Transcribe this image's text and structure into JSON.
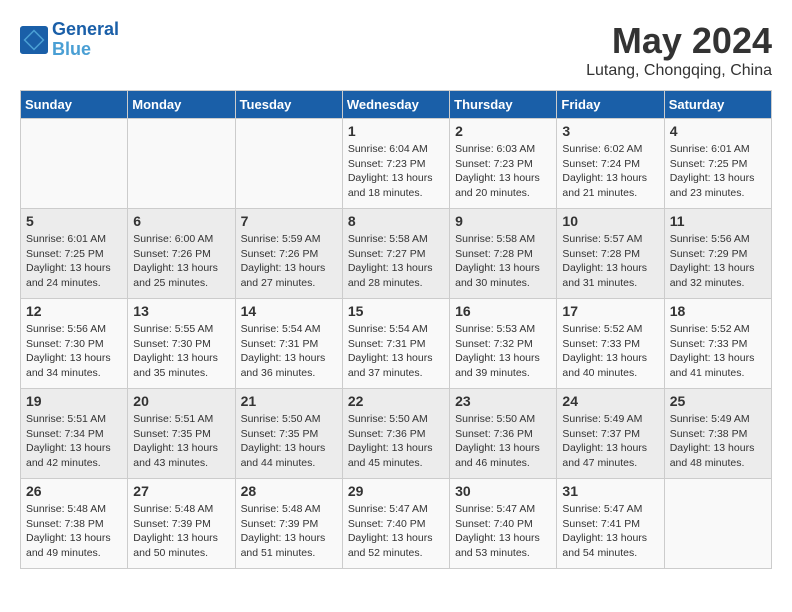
{
  "header": {
    "logo_line1": "General",
    "logo_line2": "Blue",
    "main_title": "May 2024",
    "subtitle": "Lutang, Chongqing, China"
  },
  "weekdays": [
    "Sunday",
    "Monday",
    "Tuesday",
    "Wednesday",
    "Thursday",
    "Friday",
    "Saturday"
  ],
  "weeks": [
    [
      {
        "day": "",
        "info": ""
      },
      {
        "day": "",
        "info": ""
      },
      {
        "day": "",
        "info": ""
      },
      {
        "day": "1",
        "info": "Sunrise: 6:04 AM\nSunset: 7:23 PM\nDaylight: 13 hours and 18 minutes."
      },
      {
        "day": "2",
        "info": "Sunrise: 6:03 AM\nSunset: 7:23 PM\nDaylight: 13 hours and 20 minutes."
      },
      {
        "day": "3",
        "info": "Sunrise: 6:02 AM\nSunset: 7:24 PM\nDaylight: 13 hours and 21 minutes."
      },
      {
        "day": "4",
        "info": "Sunrise: 6:01 AM\nSunset: 7:25 PM\nDaylight: 13 hours and 23 minutes."
      }
    ],
    [
      {
        "day": "5",
        "info": "Sunrise: 6:01 AM\nSunset: 7:25 PM\nDaylight: 13 hours and 24 minutes."
      },
      {
        "day": "6",
        "info": "Sunrise: 6:00 AM\nSunset: 7:26 PM\nDaylight: 13 hours and 25 minutes."
      },
      {
        "day": "7",
        "info": "Sunrise: 5:59 AM\nSunset: 7:26 PM\nDaylight: 13 hours and 27 minutes."
      },
      {
        "day": "8",
        "info": "Sunrise: 5:58 AM\nSunset: 7:27 PM\nDaylight: 13 hours and 28 minutes."
      },
      {
        "day": "9",
        "info": "Sunrise: 5:58 AM\nSunset: 7:28 PM\nDaylight: 13 hours and 30 minutes."
      },
      {
        "day": "10",
        "info": "Sunrise: 5:57 AM\nSunset: 7:28 PM\nDaylight: 13 hours and 31 minutes."
      },
      {
        "day": "11",
        "info": "Sunrise: 5:56 AM\nSunset: 7:29 PM\nDaylight: 13 hours and 32 minutes."
      }
    ],
    [
      {
        "day": "12",
        "info": "Sunrise: 5:56 AM\nSunset: 7:30 PM\nDaylight: 13 hours and 34 minutes."
      },
      {
        "day": "13",
        "info": "Sunrise: 5:55 AM\nSunset: 7:30 PM\nDaylight: 13 hours and 35 minutes."
      },
      {
        "day": "14",
        "info": "Sunrise: 5:54 AM\nSunset: 7:31 PM\nDaylight: 13 hours and 36 minutes."
      },
      {
        "day": "15",
        "info": "Sunrise: 5:54 AM\nSunset: 7:31 PM\nDaylight: 13 hours and 37 minutes."
      },
      {
        "day": "16",
        "info": "Sunrise: 5:53 AM\nSunset: 7:32 PM\nDaylight: 13 hours and 39 minutes."
      },
      {
        "day": "17",
        "info": "Sunrise: 5:52 AM\nSunset: 7:33 PM\nDaylight: 13 hours and 40 minutes."
      },
      {
        "day": "18",
        "info": "Sunrise: 5:52 AM\nSunset: 7:33 PM\nDaylight: 13 hours and 41 minutes."
      }
    ],
    [
      {
        "day": "19",
        "info": "Sunrise: 5:51 AM\nSunset: 7:34 PM\nDaylight: 13 hours and 42 minutes."
      },
      {
        "day": "20",
        "info": "Sunrise: 5:51 AM\nSunset: 7:35 PM\nDaylight: 13 hours and 43 minutes."
      },
      {
        "day": "21",
        "info": "Sunrise: 5:50 AM\nSunset: 7:35 PM\nDaylight: 13 hours and 44 minutes."
      },
      {
        "day": "22",
        "info": "Sunrise: 5:50 AM\nSunset: 7:36 PM\nDaylight: 13 hours and 45 minutes."
      },
      {
        "day": "23",
        "info": "Sunrise: 5:50 AM\nSunset: 7:36 PM\nDaylight: 13 hours and 46 minutes."
      },
      {
        "day": "24",
        "info": "Sunrise: 5:49 AM\nSunset: 7:37 PM\nDaylight: 13 hours and 47 minutes."
      },
      {
        "day": "25",
        "info": "Sunrise: 5:49 AM\nSunset: 7:38 PM\nDaylight: 13 hours and 48 minutes."
      }
    ],
    [
      {
        "day": "26",
        "info": "Sunrise: 5:48 AM\nSunset: 7:38 PM\nDaylight: 13 hours and 49 minutes."
      },
      {
        "day": "27",
        "info": "Sunrise: 5:48 AM\nSunset: 7:39 PM\nDaylight: 13 hours and 50 minutes."
      },
      {
        "day": "28",
        "info": "Sunrise: 5:48 AM\nSunset: 7:39 PM\nDaylight: 13 hours and 51 minutes."
      },
      {
        "day": "29",
        "info": "Sunrise: 5:47 AM\nSunset: 7:40 PM\nDaylight: 13 hours and 52 minutes."
      },
      {
        "day": "30",
        "info": "Sunrise: 5:47 AM\nSunset: 7:40 PM\nDaylight: 13 hours and 53 minutes."
      },
      {
        "day": "31",
        "info": "Sunrise: 5:47 AM\nSunset: 7:41 PM\nDaylight: 13 hours and 54 minutes."
      },
      {
        "day": "",
        "info": ""
      }
    ]
  ]
}
